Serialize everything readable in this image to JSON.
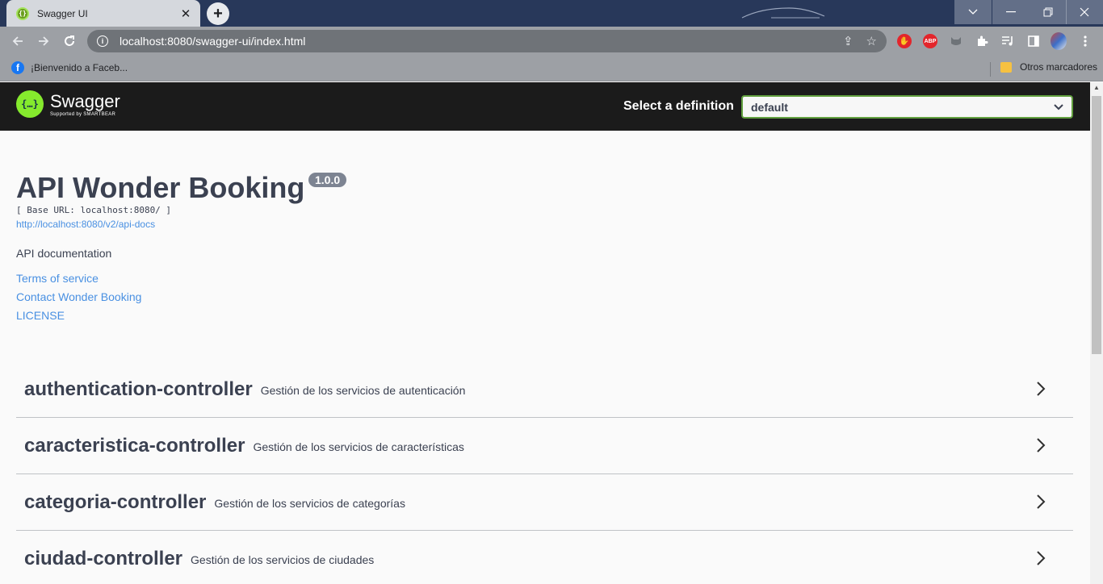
{
  "browser": {
    "tab_title": "Swagger UI",
    "tab_close": "✕",
    "new_tab": "+",
    "url": "localhost:8080/swagger-ui/index.html",
    "bookmarks": [
      {
        "label": "¡Bienvenido a Faceb...",
        "icon": "facebook-icon"
      },
      {
        "label": "Otros marcadores",
        "icon": "folder-icon"
      }
    ],
    "extensions": {
      "abp": "ABP"
    }
  },
  "swagger": {
    "logo_name": "Swagger",
    "logo_sub": "Supported by SMARTBEAR",
    "select_label": "Select a definition",
    "selected_definition": "default"
  },
  "info": {
    "title": "API Wonder Booking",
    "version": "1.0.0",
    "base_url": "[ Base URL: localhost:8080/ ]",
    "spec_link": "http://localhost:8080/v2/api-docs",
    "description": "API documentation",
    "links": [
      "Terms of service",
      "Contact Wonder Booking",
      "LICENSE"
    ]
  },
  "tags": [
    {
      "name": "authentication-controller",
      "description": "Gestión de los servicios de autenticación"
    },
    {
      "name": "caracteristica-controller",
      "description": "Gestión de los servicios de características"
    },
    {
      "name": "categoria-controller",
      "description": "Gestión de los servicios de categorías"
    },
    {
      "name": "ciudad-controller",
      "description": "Gestión de los servicios de ciudades"
    }
  ],
  "colors": {
    "topbar": "#1b1b1b",
    "accent_green": "#85ea2d",
    "link": "#4990e2",
    "text": "#3b4151"
  }
}
